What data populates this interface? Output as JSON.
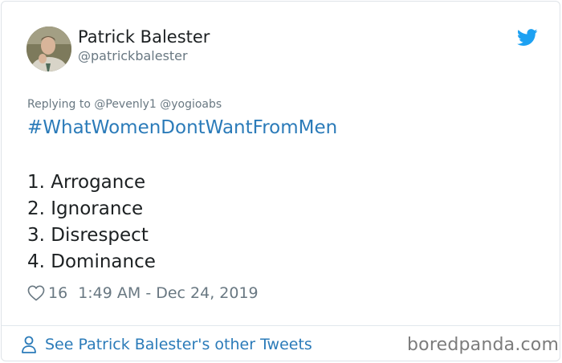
{
  "tweet": {
    "display_name": "Patrick Balester",
    "handle": "@patrickbalester",
    "reply_context": "Replying to @Pevenly1 @yogioabs",
    "hashtag": "#WhatWomenDontWantFromMen",
    "list_items": [
      "1. Arrogance",
      "2. Ignorance",
      "3. Disrespect",
      "4. Dominance"
    ],
    "like_count": "16",
    "timestamp": "1:49 AM - Dec 24, 2019"
  },
  "footer": {
    "link_label": "See Patrick Balester's other Tweets",
    "watermark": "boredpanda.com"
  },
  "icons": {
    "brand": "twitter-bird-icon",
    "like": "heart-icon",
    "profile": "person-icon"
  },
  "colors": {
    "twitter_blue": "#1da1f2",
    "link_blue": "#2b7bb9",
    "text_dark": "#1c2022",
    "text_muted": "#697882"
  }
}
